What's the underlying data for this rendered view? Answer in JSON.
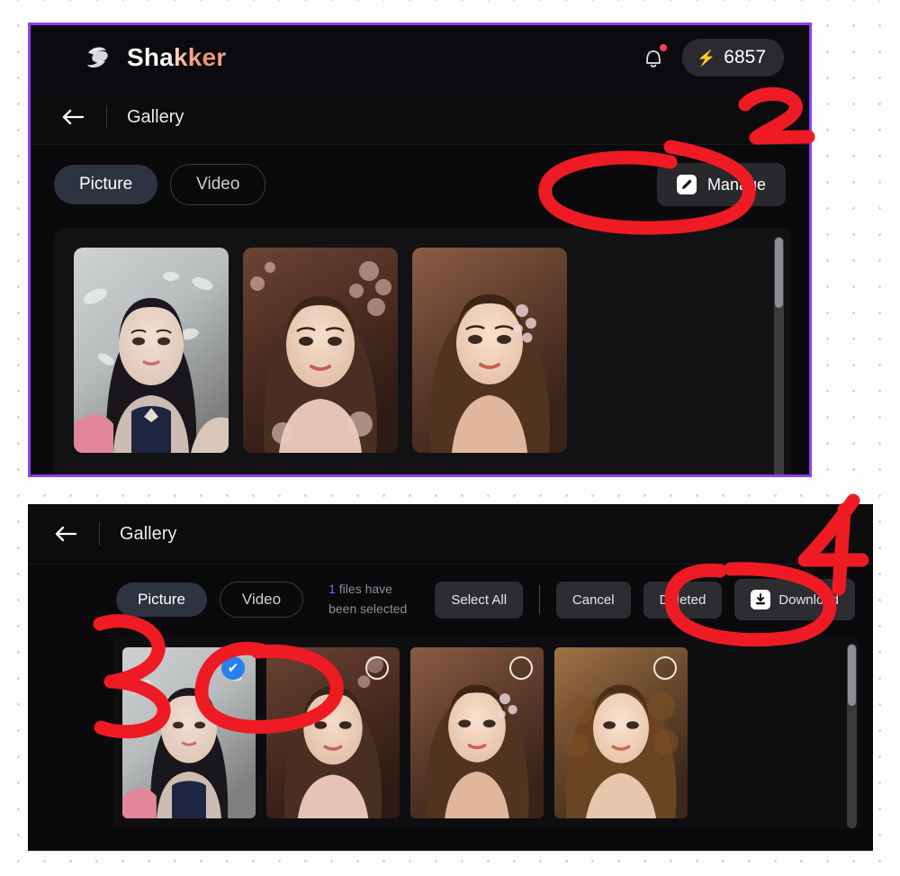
{
  "background": {
    "color": "#fdfdfd",
    "dot_color": "#d6d6d8"
  },
  "panel_top": {
    "border_color": "#8d3ff0",
    "app_header": {
      "brand_name": "Shakker",
      "logo_icon": "shakker-logo-icon",
      "bell_icon": "notification-bell-icon",
      "bell_has_badge": true,
      "credits": {
        "icon": "lightning-bolt-icon",
        "value": "6857"
      }
    },
    "sub_header": {
      "back_icon": "back-arrow-icon",
      "title": "Gallery"
    },
    "toolbar": {
      "tabs": [
        {
          "label": "Picture",
          "active": true
        },
        {
          "label": "Video",
          "active": false
        }
      ],
      "manage": {
        "label": "Manage",
        "icon": "pencil-edit-icon"
      }
    },
    "gallery": {
      "thumbnails": [
        {
          "name": "portrait-white-floral",
          "alt": "woman portrait with white blossom background"
        },
        {
          "name": "portrait-sepia-blossom",
          "alt": "sepia portrait with pink blossoms"
        },
        {
          "name": "portrait-brown-flowers",
          "alt": "brown toned portrait with hair flowers"
        }
      ],
      "scrollbar": true
    }
  },
  "panel_bottom": {
    "sub_header": {
      "back_icon": "back-arrow-icon",
      "title": "Gallery"
    },
    "toolbar": {
      "tabs": [
        {
          "label": "Picture",
          "active": true
        },
        {
          "label": "Video",
          "active": false
        }
      ],
      "selection_count": "1",
      "selection_text": " files have been selected",
      "buttons": [
        {
          "label": "Select All",
          "icon": null
        },
        {
          "label": "Cancel",
          "icon": null
        },
        {
          "label": "Deleted",
          "icon": null
        },
        {
          "label": "Download",
          "icon": "download-icon"
        }
      ]
    },
    "gallery": {
      "thumbnails": [
        {
          "name": "portrait-white-floral",
          "selected": true
        },
        {
          "name": "portrait-sepia-blossom",
          "selected": false
        },
        {
          "name": "portrait-brown-flowers",
          "selected": false
        },
        {
          "name": "portrait-curly-warm",
          "selected": false
        }
      ],
      "check_on_color": "#2a7fef",
      "scrollbar": true
    }
  },
  "annotations": {
    "color": "#ee1b24",
    "marks": [
      {
        "name": "annotation-number-2",
        "label": "2"
      },
      {
        "name": "annotation-circle-manage",
        "label": ""
      },
      {
        "name": "annotation-number-4",
        "label": "4"
      },
      {
        "name": "annotation-circle-download",
        "label": ""
      },
      {
        "name": "annotation-number-3",
        "label": "3"
      },
      {
        "name": "annotation-circle-checkbox",
        "label": ""
      }
    ]
  }
}
